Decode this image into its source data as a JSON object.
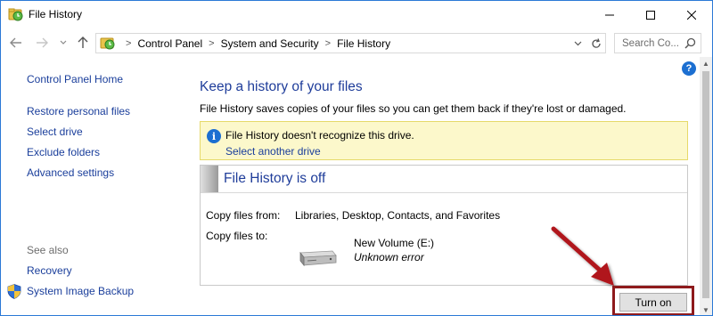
{
  "window": {
    "title": "File History",
    "controls": {
      "minimize": "–",
      "maximize": "☐",
      "close": "✕"
    }
  },
  "nav": {
    "breadcrumbs": [
      "Control Panel",
      "System and Security",
      "File History"
    ],
    "separator": ">",
    "search_placeholder": "Search Co..."
  },
  "sidebar": {
    "links": [
      "Control Panel Home",
      "Restore personal files",
      "Select drive",
      "Exclude folders",
      "Advanced settings"
    ],
    "see_also_label": "See also",
    "see_also_links": [
      "Recovery",
      "System Image Backup"
    ]
  },
  "main": {
    "heading": "Keep a history of your files",
    "description": "File History saves copies of your files so you can get them back if they're lost or damaged.",
    "info": {
      "message": "File History doesn't recognize this drive.",
      "link": "Select another drive"
    },
    "status": {
      "title": "File History is off",
      "copy_from_label": "Copy files from:",
      "copy_from_value": "Libraries, Desktop, Contacts, and Favorites",
      "copy_to_label": "Copy files to:",
      "drive_name": "New Volume (E:)",
      "drive_status": "Unknown error"
    },
    "turn_on_label": "Turn on"
  },
  "colors": {
    "link": "#1a3e9b",
    "heading": "#1f3d9a",
    "info_bg": "#fcf8cb",
    "highlight": "#8e1a1c",
    "accent": "#1c6fd1"
  }
}
